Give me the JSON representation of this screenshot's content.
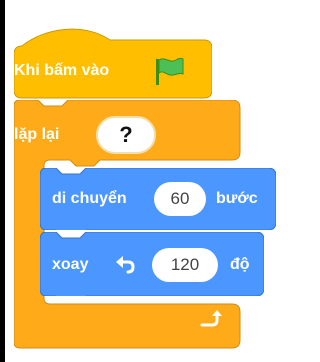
{
  "hat": {
    "label": "Khi bấm vào",
    "icon": "green-flag-icon"
  },
  "repeat": {
    "label": "lặp lại",
    "count": "?",
    "end_icon": "loop-arrow-icon"
  },
  "move": {
    "label": "di chuyển",
    "value": "60",
    "unit": "bước"
  },
  "turn": {
    "label": "xoay",
    "icon": "rotate-left-icon",
    "value": "120",
    "unit": "độ"
  },
  "colors": {
    "events": "#FFBF00",
    "control": "#FFAB19",
    "motion": "#4C97FF"
  }
}
